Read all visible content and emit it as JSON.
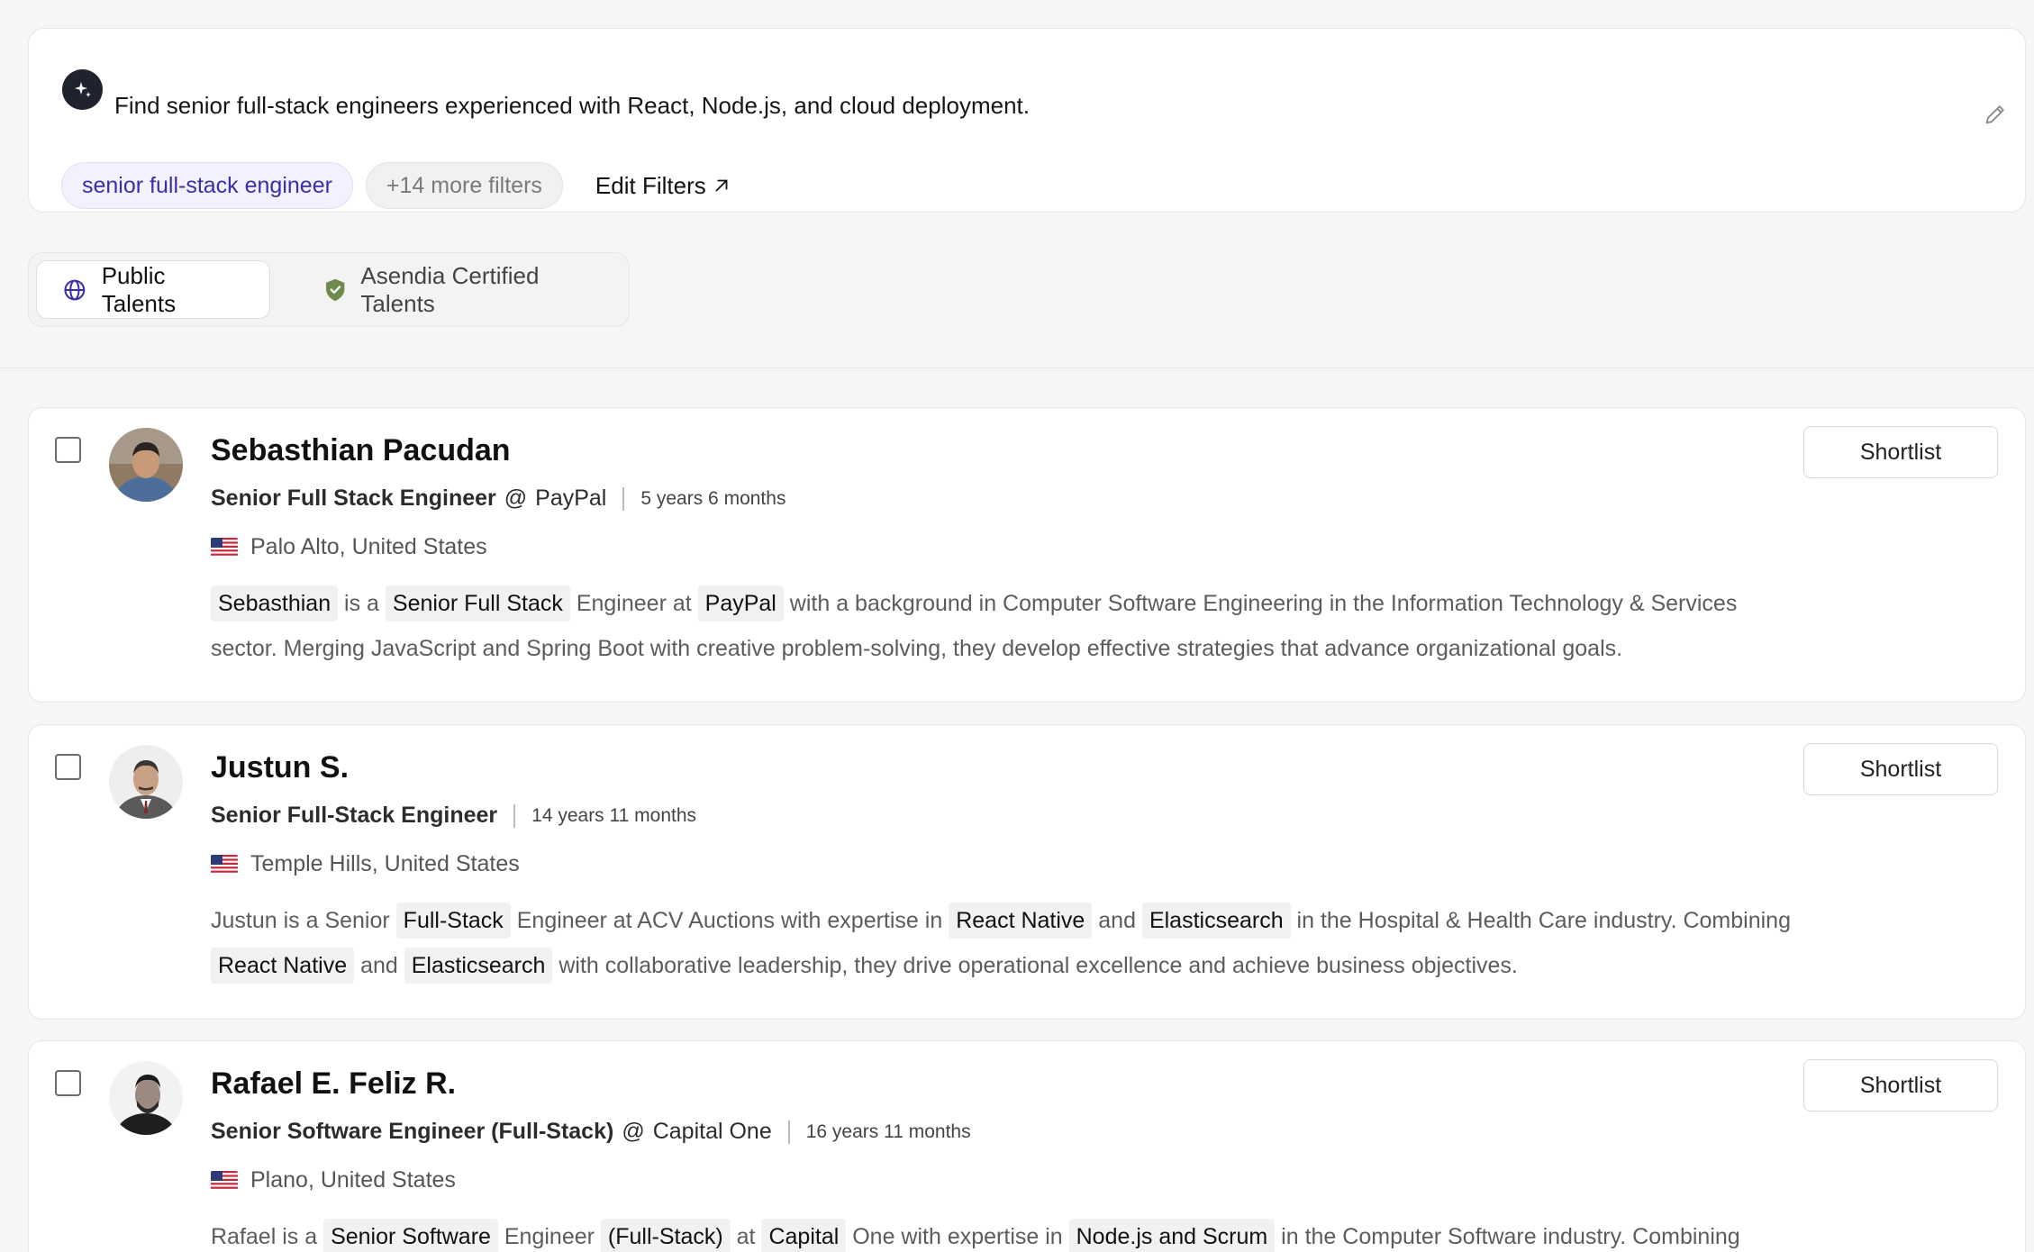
{
  "query": {
    "text": "Find senior full-stack engineers experienced with React, Node.js, and cloud deployment.",
    "chips": [
      "senior full-stack engineer",
      "+14 more filters"
    ],
    "edit_filters_label": "Edit Filters"
  },
  "tabs": {
    "public": "Public Talents",
    "certified": "Asendia Certified Talents"
  },
  "candidates": [
    {
      "name": "Sebasthian Pacudan",
      "role": "Senior Full Stack Engineer",
      "company_sep": "@",
      "company": "PayPal",
      "tenure": "5 years 6 months",
      "location": "Palo Alto, United States",
      "shortlist_label": "Shortlist",
      "summary": [
        {
          "t": "Sebasthian",
          "h": true
        },
        {
          "t": " is a ",
          "h": false
        },
        {
          "t": "Senior Full Stack",
          "h": true
        },
        {
          "t": " Engineer at ",
          "h": false
        },
        {
          "t": "PayPal",
          "h": true
        },
        {
          "t": " with a background in Computer Software Engineering in the Information Technology & Services sector. Merging JavaScript and Spring Boot with creative problem-solving, they develop effective strategies that advance organizational goals.",
          "h": false
        }
      ]
    },
    {
      "name": "Justun S.",
      "role": "Senior Full-Stack Engineer",
      "company_sep": "",
      "company": "",
      "tenure": "14 years 11 months",
      "location": "Temple Hills, United States",
      "shortlist_label": "Shortlist",
      "summary": [
        {
          "t": "Justun is a Senior ",
          "h": false
        },
        {
          "t": "Full-Stack",
          "h": true
        },
        {
          "t": " Engineer at ACV Auctions with expertise in ",
          "h": false
        },
        {
          "t": "React Native",
          "h": true
        },
        {
          "t": " and ",
          "h": false
        },
        {
          "t": "Elasticsearch",
          "h": true
        },
        {
          "t": " in the Hospital & Health Care industry. Combining ",
          "h": false
        },
        {
          "t": "React Native",
          "h": true
        },
        {
          "t": " and ",
          "h": false
        },
        {
          "t": "Elasticsearch",
          "h": true
        },
        {
          "t": " with collaborative leadership, they drive operational excellence and achieve business objectives.",
          "h": false
        }
      ]
    },
    {
      "name": "Rafael E. Feliz R.",
      "role": "Senior Software Engineer (Full-Stack)",
      "company_sep": "@",
      "company": "Capital One",
      "tenure": "16 years 11 months",
      "location": "Plano, United States",
      "shortlist_label": "Shortlist",
      "summary": [
        {
          "t": "Rafael is a ",
          "h": false
        },
        {
          "t": "Senior Software",
          "h": true
        },
        {
          "t": " Engineer ",
          "h": false
        },
        {
          "t": "(Full-Stack)",
          "h": true
        },
        {
          "t": " at ",
          "h": false
        },
        {
          "t": "Capital",
          "h": true
        },
        {
          "t": " One with expertise in ",
          "h": false
        },
        {
          "t": "Node.js and Scrum",
          "h": true
        },
        {
          "t": " in the Computer Software industry. Combining",
          "h": false
        }
      ]
    }
  ],
  "colors": {
    "accent_chip": "#3b2fa6",
    "certified_shield": "#6f8a4e",
    "ai_badge": "#1f2330"
  },
  "icons": [
    "sparkle-icon",
    "pencil-icon",
    "arrow-up-right-icon",
    "globe-icon",
    "shield-check-icon",
    "us-flag-icon"
  ]
}
